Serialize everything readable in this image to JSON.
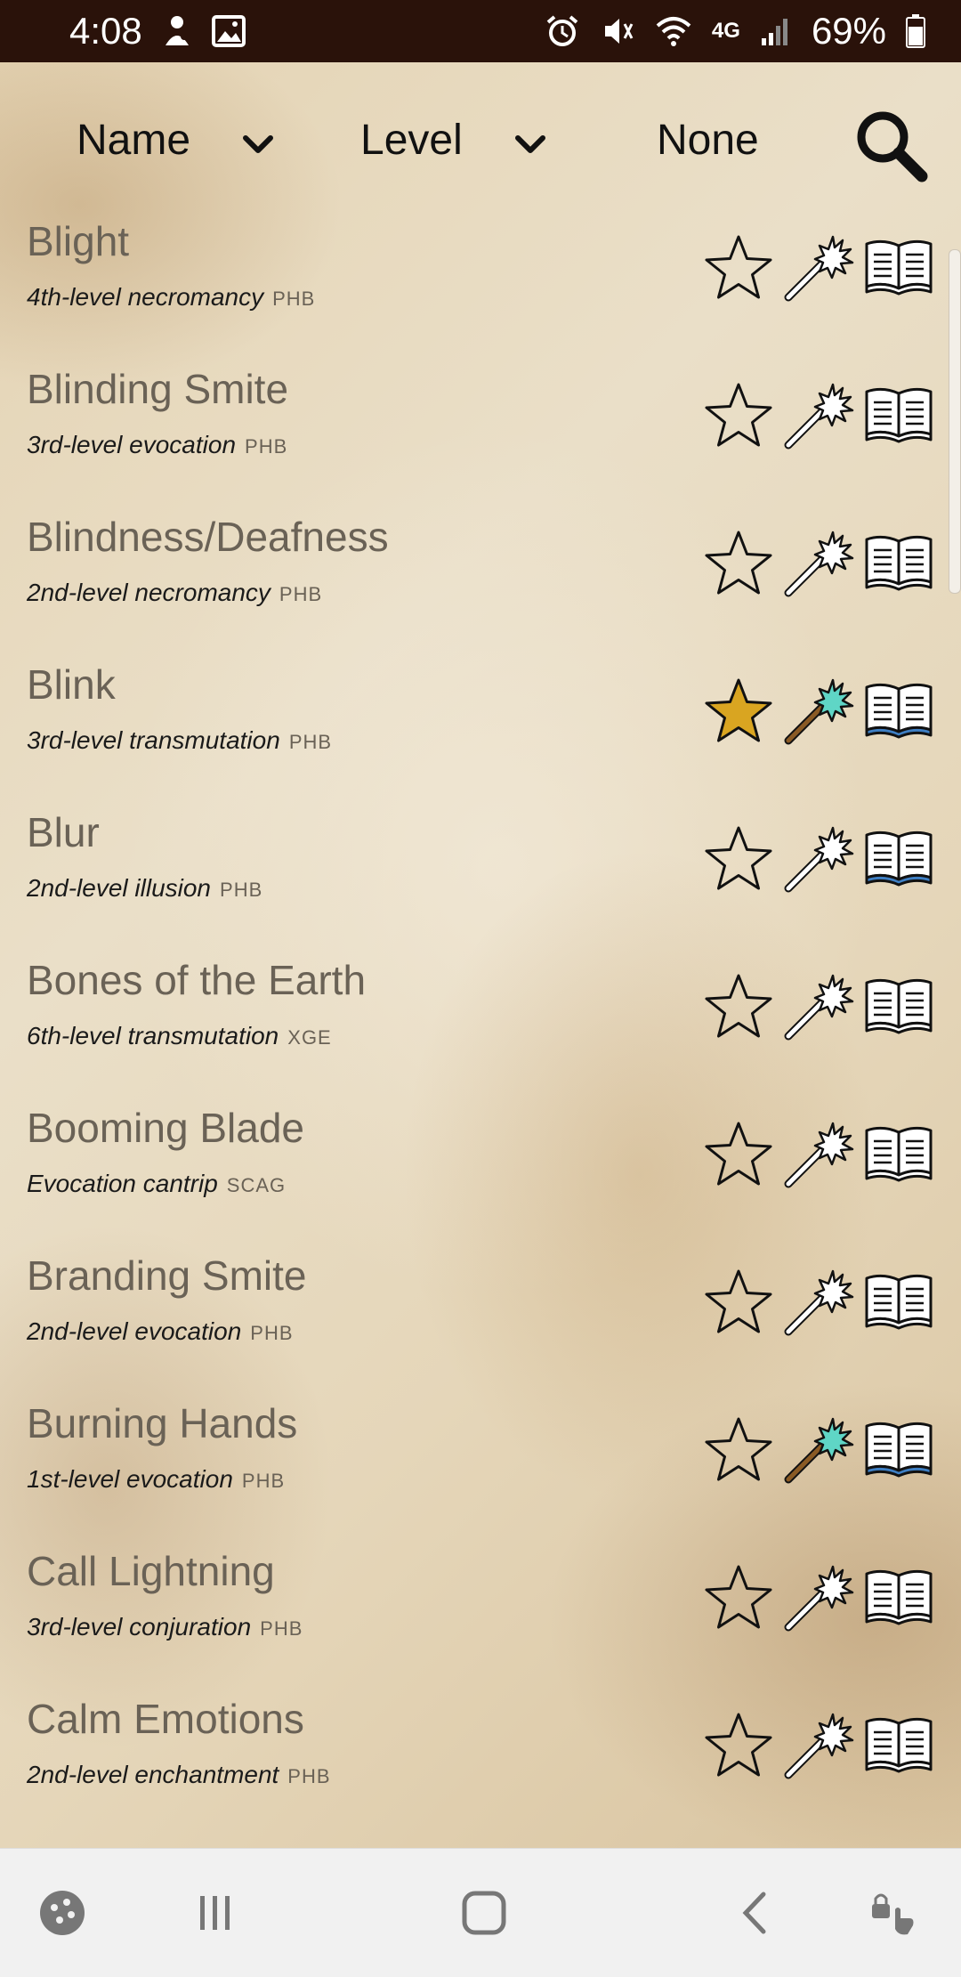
{
  "status_bar": {
    "time": "4:08",
    "network": "4G",
    "battery": "69%"
  },
  "header": {
    "sort1": "Name",
    "sort2": "Level",
    "filter": "None"
  },
  "spells": [
    {
      "name": "Blight",
      "desc": "4th-level necromancy",
      "source": "PHB",
      "favorite": false,
      "prepared": false,
      "known": false
    },
    {
      "name": "Blinding Smite",
      "desc": "3rd-level evocation",
      "source": "PHB",
      "favorite": false,
      "prepared": false,
      "known": false
    },
    {
      "name": "Blindness/Deafness",
      "desc": "2nd-level necromancy",
      "source": "PHB",
      "favorite": false,
      "prepared": false,
      "known": false
    },
    {
      "name": "Blink",
      "desc": "3rd-level transmutation",
      "source": "PHB",
      "favorite": true,
      "prepared": true,
      "known": true
    },
    {
      "name": "Blur",
      "desc": "2nd-level illusion",
      "source": "PHB",
      "favorite": false,
      "prepared": false,
      "known": true
    },
    {
      "name": "Bones of the Earth",
      "desc": "6th-level transmutation",
      "source": "XGE",
      "favorite": false,
      "prepared": false,
      "known": false
    },
    {
      "name": "Booming Blade",
      "desc": "Evocation cantrip",
      "source": "SCAG",
      "favorite": false,
      "prepared": false,
      "known": false
    },
    {
      "name": "Branding Smite",
      "desc": "2nd-level evocation",
      "source": "PHB",
      "favorite": false,
      "prepared": false,
      "known": false
    },
    {
      "name": "Burning Hands",
      "desc": "1st-level evocation",
      "source": "PHB",
      "favorite": false,
      "prepared": true,
      "known": true
    },
    {
      "name": "Call Lightning",
      "desc": "3rd-level conjuration",
      "source": "PHB",
      "favorite": false,
      "prepared": false,
      "known": false
    },
    {
      "name": "Calm Emotions",
      "desc": "2nd-level enchantment",
      "source": "PHB",
      "favorite": false,
      "prepared": false,
      "known": false
    }
  ],
  "colors": {
    "star_active": "#d9a521",
    "wand_active": "#5fd6c6",
    "book_active": "#3e7fc4",
    "status_bar": "#2a120a"
  }
}
